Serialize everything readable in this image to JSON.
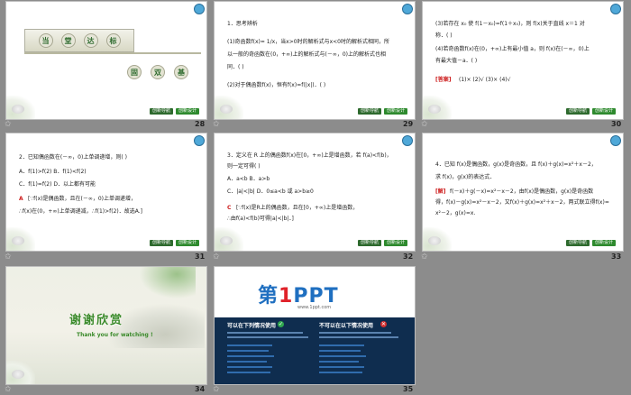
{
  "slides": [
    {
      "num": "28",
      "title_chars": [
        "当",
        "堂",
        "达",
        "标"
      ],
      "sub_chars": [
        "固",
        "双",
        "基"
      ],
      "buttons": [
        "创新导航",
        "创新设计"
      ]
    },
    {
      "num": "29",
      "lines": [
        "1．思考辨析",
        "(1)奇函数f(x)= 1/x，当x>0时的解析式与x<0时的解析式相同，所",
        "以一般的奇函数在(0，+∞)上的解析式与(－∞，0)上的解析式也相",
        "同．(     )",
        "(2)对于偶函数f(x)，恒有f(x)=f(|x|)．(     )"
      ],
      "buttons": [
        "创新导航",
        "创新设计"
      ]
    },
    {
      "num": "30",
      "lines": [
        "(3)若存在 x₀ 使 f(1－x₀)=f(1＋x₀)，则 f(x)关于直线 x＝1 对",
        "称．(     )",
        "(4)若奇函数f(x)在(0，+∞)上有最小值 a，则 f(x)在(－∞，0)上",
        "有最大值－a．(     )"
      ],
      "answer_label": "[答案]",
      "answer_text": "(1)×   (2)√   (3)×   (4)√",
      "buttons": [
        "创新导航",
        "创新设计"
      ]
    },
    {
      "num": "31",
      "lines": [
        "2．已知偶函数在(－∞，0)上单调递增，则(     )",
        "A．f(1)>f(2)          B．f(1)<f(2)",
        "C．f(1)=f(2)          D．以上都有可能"
      ],
      "answer_label": "A",
      "answer_text": "[∵f(x)是偶函数，且在(－∞，0)上单调递增，",
      "answer_text2": "∴f(x)在(0，+∞)上单调递减，∴f(1)>f(2)．故选A.]",
      "buttons": [
        "创新导航",
        "创新设计"
      ]
    },
    {
      "num": "32",
      "lines": [
        "3．定义在 R 上的偶函数f(x)在[0，+∞)上是增函数，若 f(a)<f(b)，",
        "则一定可得(     )",
        "A．a<b                 B．a>b",
        "C．|a|<|b|             D．0≤a<b 或 a>b≥0"
      ],
      "answer_label": "C",
      "answer_text": "[∵f(x)是R上的偶函数，且在[0，+∞)上是增函数，",
      "answer_text2": "∴由f(a)<f(b)可得|a|<|b|．]",
      "buttons": [
        "创新导航",
        "创新设计"
      ]
    },
    {
      "num": "33",
      "lines": [
        "4．已知 f(x)是偶函数，g(x)是奇函数，且 f(x)＋g(x)=x²＋x－2，",
        "求 f(x)，g(x)的表达式．"
      ],
      "answer_label": "[解]",
      "answer_text": "f(－x)＋g(－x)=x²－x－2，由f(x)是偶函数，g(x)是奇函数",
      "answer_text2": "得，f(x)－g(x)=x²－x－2，又f(x)＋g(x)=x²＋x－2，两式联立得f(x)=",
      "answer_text3": "x²－2，g(x)=x.",
      "buttons": [
        "创新导航",
        "创新设计"
      ]
    },
    {
      "num": "34",
      "title": "谢谢欣赏",
      "subtitle": "Thank you for watching !"
    },
    {
      "num": "35",
      "logo_main": "第",
      "logo_one": "1",
      "logo_rest": "PPT",
      "url": "www.1ppt.com",
      "left_title": "可以在下列情况使用",
      "right_title": "不可以在以下情况使用"
    }
  ]
}
